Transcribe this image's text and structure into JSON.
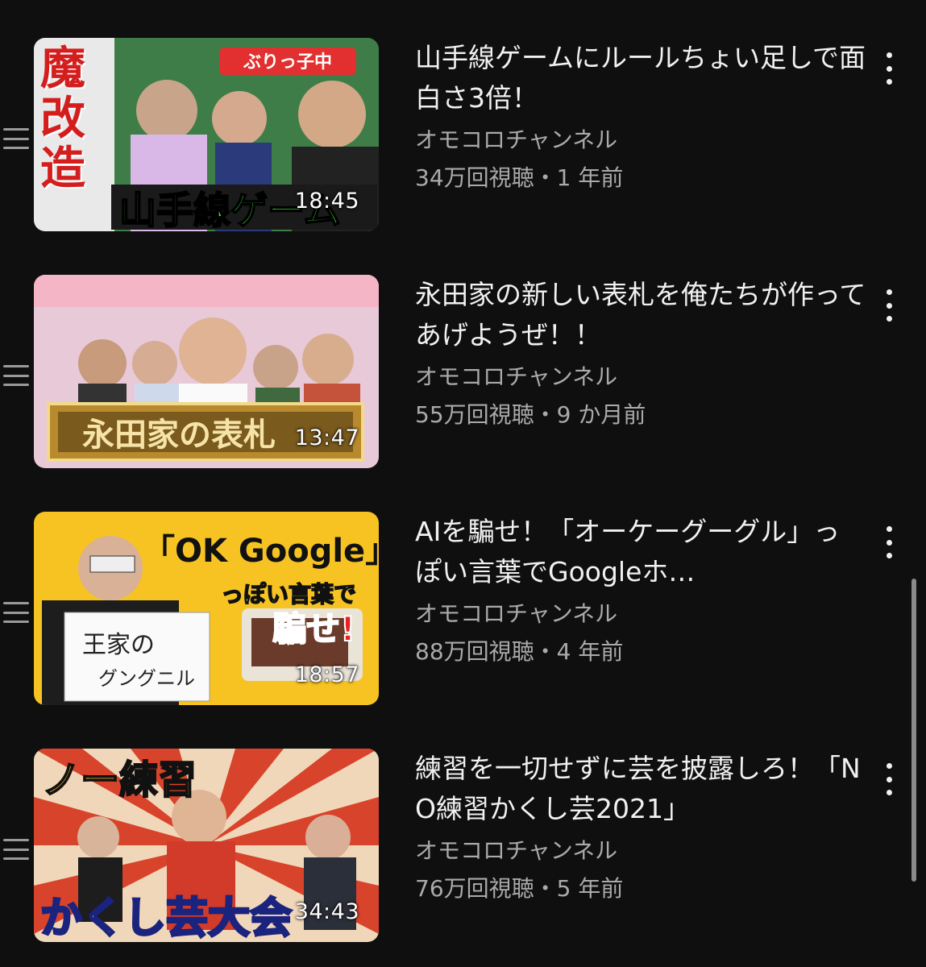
{
  "videos": [
    {
      "title": "山手線ゲームにルールちょい足しで面白さ3倍！",
      "channel": "オモコロチャンネル",
      "meta": "34万回視聴・1 年前",
      "duration": "18:45",
      "thumb_text": {
        "big": "山手線ゲーム",
        "side": "魔改造",
        "tag": "ぶりっ子中"
      }
    },
    {
      "title": "永田家の新しい表札を俺たちが作ってあげようぜ！！",
      "channel": "オモコロチャンネル",
      "meta": "55万回視聴・9 か月前",
      "duration": "13:47",
      "thumb_text": {
        "big": "永田家の表札"
      }
    },
    {
      "title": "AIを騙せ！「オーケーグーグル」っぽい言葉でGoogleホ…",
      "channel": "オモコロチャンネル",
      "meta": "88万回視聴・4 年前",
      "duration": "18:57",
      "thumb_text": {
        "big": "「OK Google」",
        "sub": "っぽい言葉で",
        "red": "騙せ!",
        "board1": "王家の",
        "board2": "グングニル"
      }
    },
    {
      "title": "練習を一切せずに芸を披露しろ！「NO練習かくし芸2021」",
      "channel": "オモコロチャンネル",
      "meta": "76万回視聴・5 年前",
      "duration": "34:43",
      "thumb_text": {
        "big": "かくし芸大会",
        "top": "ノー練習"
      }
    }
  ],
  "colors": {
    "background": "#0f0f0f",
    "title": "#f1f1f1",
    "secondary": "#aaaaaa"
  },
  "icons": {
    "drag": "drag-handle-icon",
    "more": "more-vert-icon"
  }
}
